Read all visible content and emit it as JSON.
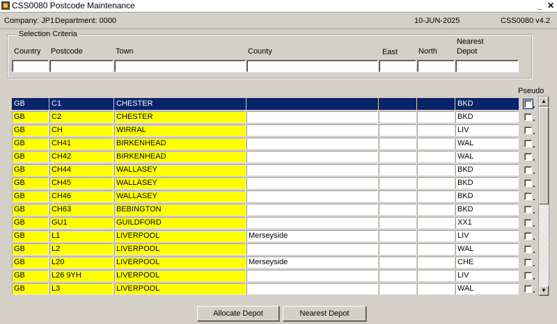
{
  "window": {
    "title": "CSS0080 Postcode Maintenance",
    "minimize": "_",
    "close": "✕"
  },
  "info": {
    "company": "Company:  JP1",
    "department": "Department:  0000",
    "date": "10-JUN-2025",
    "form_code": "CSS0080  v4.2"
  },
  "criteria": {
    "legend": "Selection Criteria",
    "headers": {
      "country": "Country",
      "postcode": "Postcode",
      "town": "Town",
      "county": "County",
      "east": "East",
      "north": "North",
      "depot_line1": "Nearest",
      "depot_line2": "Depot"
    }
  },
  "grid": {
    "pseudo_header": "Pseudo",
    "rows": [
      {
        "country": "GB",
        "postcode": "C1",
        "town": "CHESTER",
        "county": "",
        "depot": "BKD"
      },
      {
        "country": "GB",
        "postcode": "C2",
        "town": "CHESTER",
        "county": "",
        "depot": "BKD"
      },
      {
        "country": "GB",
        "postcode": "CH",
        "town": "WIRRAL",
        "county": "",
        "depot": "LIV"
      },
      {
        "country": "GB",
        "postcode": "CH41",
        "town": "BIRKENHEAD",
        "county": "",
        "depot": "WAL"
      },
      {
        "country": "GB",
        "postcode": "CH42",
        "town": "BIRKENHEAD",
        "county": "",
        "depot": "WAL"
      },
      {
        "country": "GB",
        "postcode": "CH44",
        "town": "WALLASEY",
        "county": "",
        "depot": "BKD"
      },
      {
        "country": "GB",
        "postcode": "CH45",
        "town": "WALLASEY",
        "county": "",
        "depot": "BKD"
      },
      {
        "country": "GB",
        "postcode": "CH46",
        "town": "WALLASEY",
        "county": "",
        "depot": "BKD"
      },
      {
        "country": "GB",
        "postcode": "CH63",
        "town": "BEBINGTON",
        "county": "",
        "depot": "BKD"
      },
      {
        "country": "GB",
        "postcode": "GU1",
        "town": "GUILDFORD",
        "county": "",
        "depot": "XX1"
      },
      {
        "country": "GB",
        "postcode": "L1",
        "town": "LIVERPOOL",
        "county": "Merseyside",
        "depot": "LIV"
      },
      {
        "country": "GB",
        "postcode": "L2",
        "town": "LIVERPOOL",
        "county": "",
        "depot": "WAL"
      },
      {
        "country": "GB",
        "postcode": "L20",
        "town": "LIVERPOOL",
        "county": "Merseyside",
        "depot": "CHE"
      },
      {
        "country": "GB",
        "postcode": "L26 9YH",
        "town": "LIVERPOOL",
        "county": "",
        "depot": "LIV"
      },
      {
        "country": "GB",
        "postcode": "L3",
        "town": "LIVERPOOL",
        "county": "",
        "depot": "WAL"
      }
    ]
  },
  "scrollbar": {
    "up": "▲",
    "down": "▼"
  },
  "buttons": {
    "allocate": "Allocate Depot",
    "nearest": "Nearest Depot"
  }
}
